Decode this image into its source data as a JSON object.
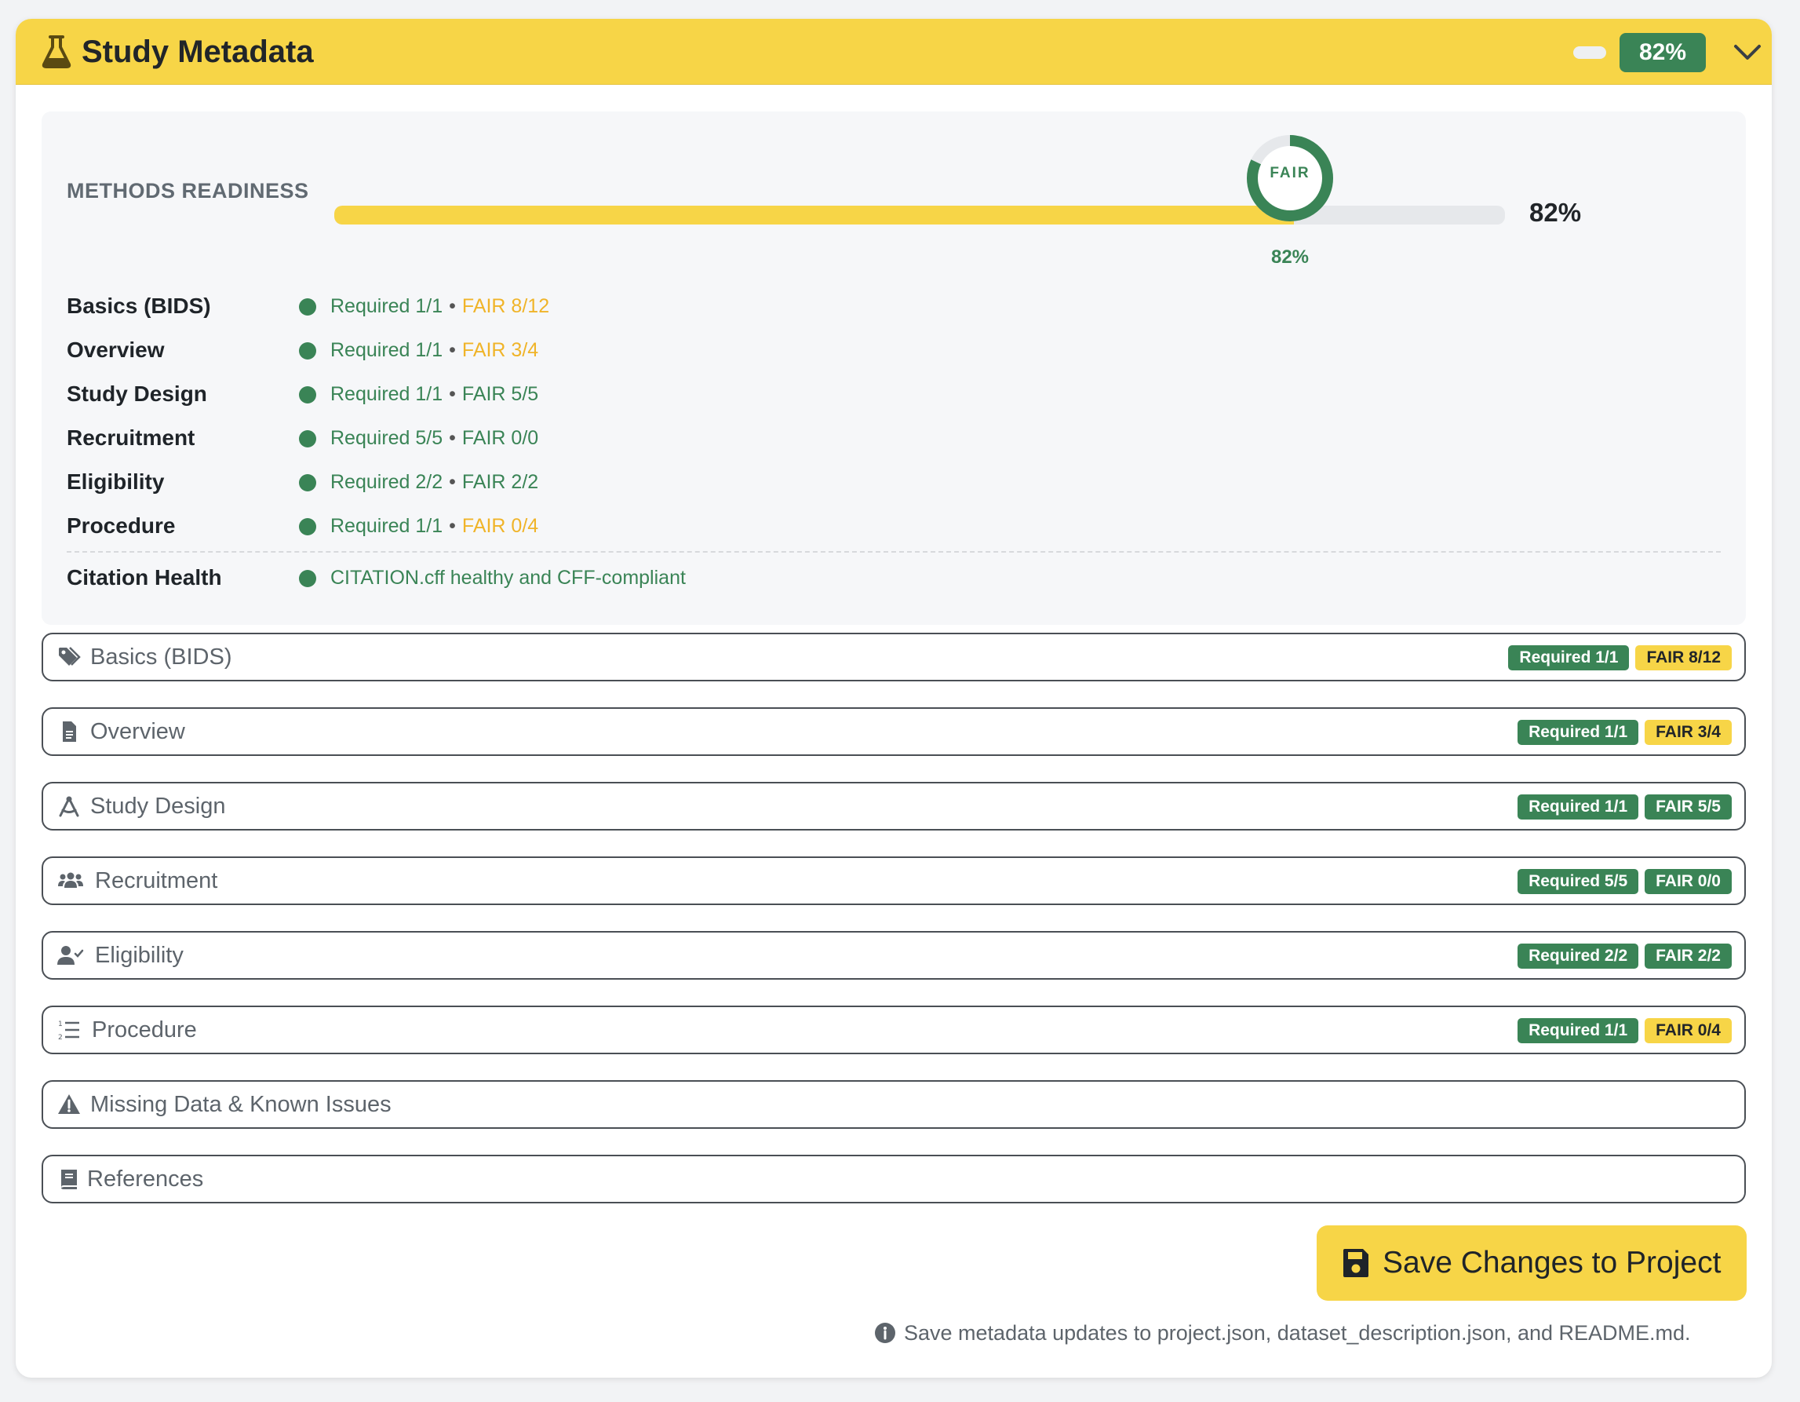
{
  "header": {
    "title": "Study Metadata",
    "percent_badge": "82%",
    "icon": "flask-icon"
  },
  "readiness": {
    "label": "METHODS READINESS",
    "progress": 0.82,
    "percent_text": "82%",
    "ring": {
      "label": "FAIR",
      "percent": "82%",
      "value": 0.82
    },
    "sections": [
      {
        "name": "Basics (BIDS)",
        "required": "Required 1/1",
        "fair": "FAIR 8/12",
        "fair_state": "partial"
      },
      {
        "name": "Overview",
        "required": "Required 1/1",
        "fair": "FAIR 3/4",
        "fair_state": "partial"
      },
      {
        "name": "Study Design",
        "required": "Required 1/1",
        "fair": "FAIR 5/5",
        "fair_state": "complete"
      },
      {
        "name": "Recruitment",
        "required": "Required 5/5",
        "fair": "FAIR 0/0",
        "fair_state": "complete"
      },
      {
        "name": "Eligibility",
        "required": "Required 2/2",
        "fair": "FAIR 2/2",
        "fair_state": "complete"
      },
      {
        "name": "Procedure",
        "required": "Required 1/1",
        "fair": "FAIR 0/4",
        "fair_state": "partial"
      }
    ],
    "citation": {
      "name": "Citation Health",
      "status": "CITATION.cff healthy and CFF-compliant"
    }
  },
  "accordions": [
    {
      "title": "Basics (BIDS)",
      "icon": "tags-icon",
      "required": "Required 1/1",
      "fair": "FAIR 8/12",
      "fair_state": "partial"
    },
    {
      "title": "Overview",
      "icon": "document-icon",
      "required": "Required 1/1",
      "fair": "FAIR 3/4",
      "fair_state": "partial"
    },
    {
      "title": "Study Design",
      "icon": "compass-drafting-icon",
      "required": "Required 1/1",
      "fair": "FAIR 5/5",
      "fair_state": "complete"
    },
    {
      "title": "Recruitment",
      "icon": "users-icon",
      "required": "Required 5/5",
      "fair": "FAIR 0/0",
      "fair_state": "complete"
    },
    {
      "title": "Eligibility",
      "icon": "user-check-icon",
      "required": "Required 2/2",
      "fair": "FAIR 2/2",
      "fair_state": "complete"
    },
    {
      "title": "Procedure",
      "icon": "numbered-list-icon",
      "required": "Required 1/1",
      "fair": "FAIR 0/4",
      "fair_state": "partial"
    },
    {
      "title": "Missing Data & Known Issues",
      "icon": "warning-icon"
    },
    {
      "title": "References",
      "icon": "book-icon"
    }
  ],
  "save": {
    "label": "Save Changes to Project",
    "icon": "floppy-disk-icon",
    "note": "Save metadata updates to project.json, dataset_description.json, and README.md."
  },
  "colors": {
    "accent_yellow": "#f7d547",
    "success_green": "#3a8456",
    "warning_amber": "#f0b429"
  }
}
